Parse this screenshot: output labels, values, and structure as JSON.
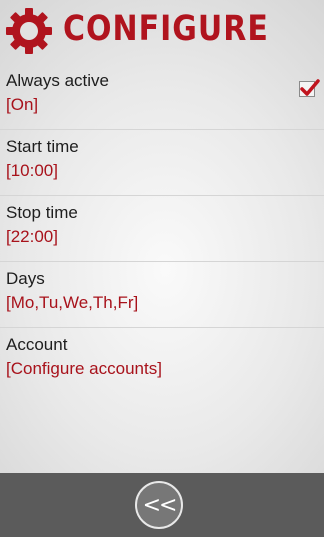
{
  "header": {
    "title": "CONFIGURE",
    "icon": "gear-icon"
  },
  "colors": {
    "accent": "#b0141e",
    "value_text": "#a8121b",
    "bottom_bar": "#5b5b5b"
  },
  "settings": [
    {
      "label": "Always active",
      "value": "[On]",
      "checked": true
    },
    {
      "label": "Start time",
      "value": "[10:00]"
    },
    {
      "label": "Stop time",
      "value": "[22:00]"
    },
    {
      "label": "Days",
      "value": "[Mo,Tu,We,Th,Fr]"
    },
    {
      "label": "Account",
      "value": "[Configure accounts]"
    }
  ],
  "footer": {
    "back_label": "<<"
  }
}
